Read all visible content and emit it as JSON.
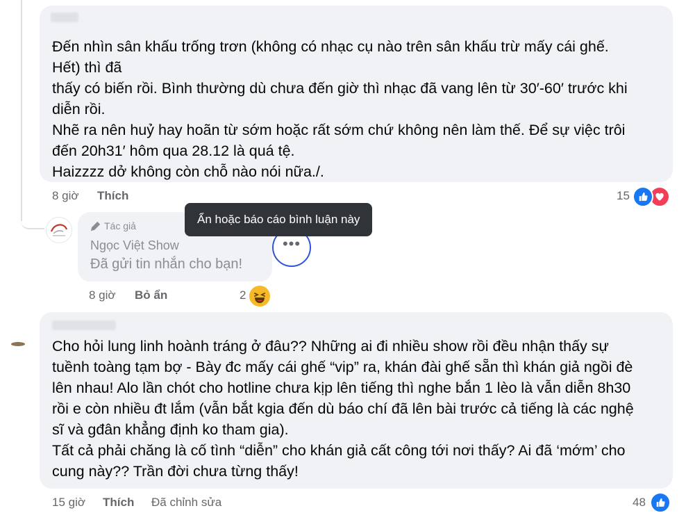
{
  "comments": [
    {
      "lines": [
        "Đến nhìn sân khấu trống trơn (không có nhạc cụ nào trên sân khấu trừ mấy cái ghế.",
        "Hết) thì đã",
        "thấy có biến rồi. Bình thường dù chưa đến giờ thì nhạc đã vang lên từ 30′-60′ trước khi",
        "diễn rồi.",
        "Nhẽ ra nên huỷ hay hoãn từ sớm hoặc rất sớm chứ không nên làm thế. Để sự việc trôi",
        "đến 20h31′ hôm qua 28.12 là quá tệ.",
        "Haizzzz dở không còn chỗ nào nói nữa./."
      ],
      "time": "8 giờ",
      "like_label": "Thích",
      "reaction_count": "15",
      "reactions": [
        "like-icon",
        "love-icon"
      ]
    },
    {
      "author_badge": "Tác giả",
      "author": "Ngọc Việt Show",
      "text": "Đã gửi tin nhắn cho bạn!",
      "time": "8 giờ",
      "unhide_label": "Bỏ ẩn",
      "reaction_count": "2",
      "reactions": [
        "haha-icon"
      ]
    },
    {
      "lines": [
        "Cho hỏi lung linh hoành tráng ở đâu?? Những ai đi nhiều show rồi đều nhận thấy sự",
        "tuềnh toàng tạm bợ - Bày đc mấy cái ghế “vip” ra, khán đài ghế sẵn thì khán giả ngồi đè",
        "lên nhau! Alo lần chót cho hotline chưa kịp lên tiếng thì nghe bắn 1 lèo là vẫn diễn 8h30",
        "rồi e còn nhiều đt lắm (vẫn bắt kgia đến dù báo chí đã lên bài trước cả tiếng là các nghệ",
        "sĩ và gđân khẳng định ko tham gia).",
        "Tất cả phải chăng là cố tình “diễn” cho khán giả cất công tới nơi thấy? Ai đã ‘mớm’ cho",
        "cung này?? Trần đời chưa từng thấy!"
      ],
      "time": "15 giờ",
      "like_label": "Thích",
      "edited_label": "Đã chỉnh sửa",
      "reaction_count": "48",
      "reactions": [
        "like-icon"
      ]
    }
  ],
  "tooltip": "Ẩn hoặc báo cáo bình luận này",
  "colors": {
    "bubble": "#f0f2f5",
    "like_blue": "#1877f2",
    "love_red": "#f33e58",
    "haha_yellow": "#f7b928",
    "focus_ring": "#2f55d4"
  }
}
